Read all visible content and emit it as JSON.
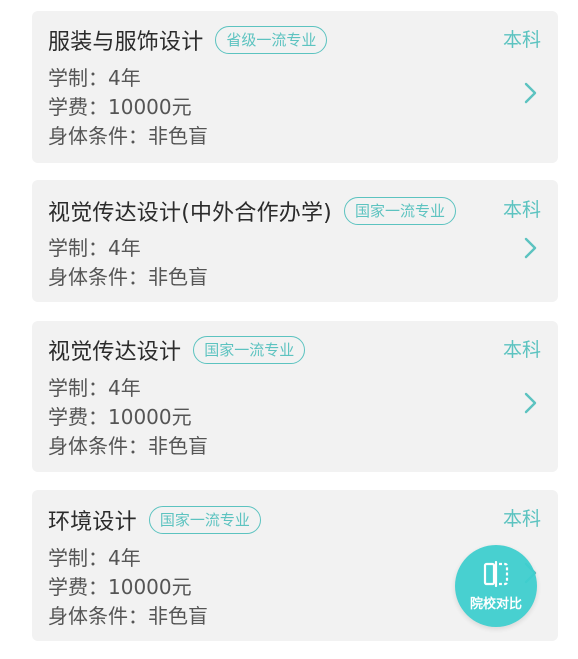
{
  "majors": [
    {
      "name": "服装与服饰设计",
      "badge": "省级一流专业",
      "level": "本科",
      "lines": [
        "学制：4年",
        "学费：10000元",
        "身体条件：非色盲"
      ]
    },
    {
      "name": "视觉传达设计(中外合作办学)",
      "badge": "国家一流专业",
      "level": "本科",
      "lines": [
        "学制：4年",
        "身体条件：非色盲"
      ]
    },
    {
      "name": "视觉传达设计",
      "badge": "国家一流专业",
      "level": "本科",
      "lines": [
        "学制：4年",
        "学费：10000元",
        "身体条件：非色盲"
      ]
    },
    {
      "name": "环境设计",
      "badge": "国家一流专业",
      "level": "本科",
      "lines": [
        "学制：4年",
        "学费：10000元",
        "身体条件：非色盲"
      ]
    }
  ],
  "compare_button": {
    "label": "院校对比",
    "icon": "compare-icon"
  },
  "colors": {
    "accent": "#5cc3c0",
    "fab": "#3fcfcf",
    "card_bg": "#f2f2f2",
    "title": "#2b2b2b",
    "text": "#555555"
  }
}
